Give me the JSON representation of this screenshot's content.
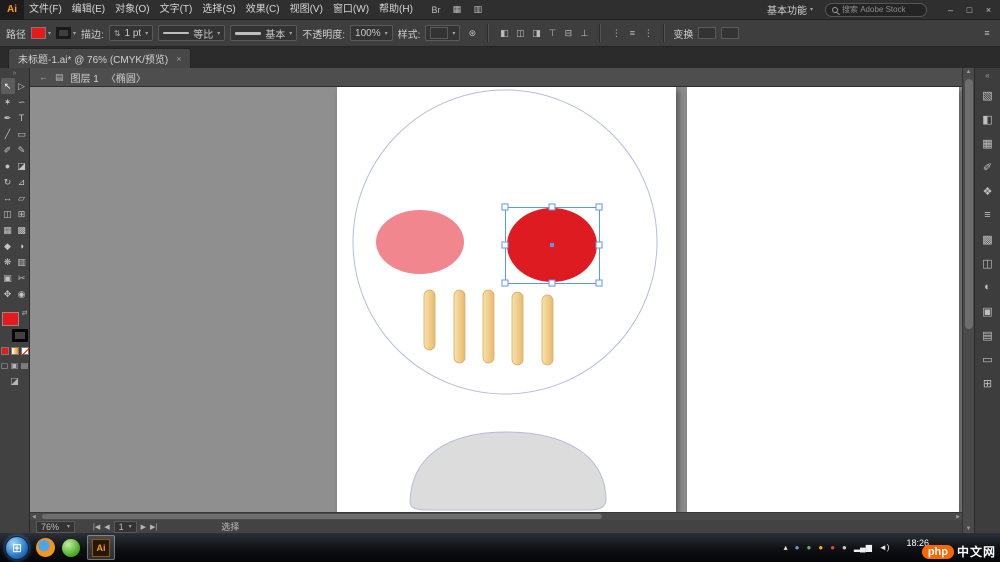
{
  "glyphs": {
    "caret_down": "▾",
    "stepper": "⇅",
    "back_arrow": "←",
    "layers": "▤",
    "dock_collapse": "«",
    "tools_collapse": "»",
    "panel_menu": "≡",
    "recolor": "⊛",
    "nav_first": "|◀",
    "nav_prev": "◀",
    "nav_next": "▶",
    "nav_last": "▶|",
    "scroll_up": "▲",
    "scroll_down": "▼",
    "scroll_left": "◀",
    "scroll_right": "▶",
    "swap": "⇄",
    "close_tab": "×",
    "start_flag": "⊞"
  },
  "menubar": {
    "app_badge": "Ai",
    "menus": [
      {
        "name": "menu-file",
        "label": "文件(F)"
      },
      {
        "name": "menu-edit",
        "label": "编辑(E)"
      },
      {
        "name": "menu-object",
        "label": "对象(O)"
      },
      {
        "name": "menu-type",
        "label": "文字(T)"
      },
      {
        "name": "menu-select",
        "label": "选择(S)"
      },
      {
        "name": "menu-effect",
        "label": "效果(C)"
      },
      {
        "name": "menu-view",
        "label": "视图(V)"
      },
      {
        "name": "menu-window",
        "label": "窗口(W)"
      },
      {
        "name": "menu-help",
        "label": "帮助(H)"
      }
    ],
    "appbar_icons": [
      {
        "name": "bridge-icon",
        "glyph": "Br"
      },
      {
        "name": "arrange-documents-icon",
        "glyph": "▦"
      },
      {
        "name": "document-layout-icon",
        "glyph": "▥"
      }
    ],
    "workspace_switcher": "基本功能",
    "search_placeholder": "搜索 Adobe Stock",
    "window_controls": [
      {
        "name": "minimize-button",
        "glyph": "–"
      },
      {
        "name": "restore-button",
        "glyph": "□"
      },
      {
        "name": "close-button",
        "glyph": "×"
      }
    ]
  },
  "control_bar": {
    "object_label": "路径",
    "fill_color": "#e8191c",
    "stroke_color": "#1a1a1a",
    "stroke_label": "描边:",
    "stroke_width": "1 pt",
    "profile_name": "等比",
    "brush_name": "基本",
    "opacity_label": "不透明度:",
    "opacity_value": "100%",
    "style_label": "样式:",
    "transform_label": "变换",
    "align_icons": [
      {
        "name": "align-left-icon",
        "glyph": "◧"
      },
      {
        "name": "align-center-horizontal-icon",
        "glyph": "◫"
      },
      {
        "name": "align-right-icon",
        "glyph": "◨"
      },
      {
        "name": "align-top-icon",
        "glyph": "⊤"
      },
      {
        "name": "align-center-vertical-icon",
        "glyph": "⊟"
      },
      {
        "name": "align-bottom-icon",
        "glyph": "⊥"
      }
    ],
    "distribute_icons": [
      {
        "name": "distribute-vertical-icon",
        "glyph": "⋮"
      },
      {
        "name": "distribute-center-icon",
        "glyph": "≡"
      },
      {
        "name": "distribute-horizontal-icon",
        "glyph": "⋮"
      }
    ]
  },
  "document_tab": {
    "title": "未标题-1.ai* @ 76% (CMYK/预览)"
  },
  "breadcrumb": {
    "items": [
      {
        "name": "breadcrumb-layer",
        "label": "图层 1"
      },
      {
        "name": "breadcrumb-ellipse",
        "label": "〈椭圆〉"
      }
    ]
  },
  "tools": [
    {
      "name": "selection-tool",
      "glyph": "↖"
    },
    {
      "name": "direct-selection-tool",
      "glyph": "▷"
    },
    {
      "name": "magic-wand-tool",
      "glyph": "✶"
    },
    {
      "name": "lasso-tool",
      "glyph": "∽"
    },
    {
      "name": "pen-tool",
      "glyph": "✒"
    },
    {
      "name": "type-tool",
      "glyph": "T"
    },
    {
      "name": "line-segment-tool",
      "glyph": "╱"
    },
    {
      "name": "rectangle-tool",
      "glyph": "▭"
    },
    {
      "name": "paintbrush-tool",
      "glyph": "✐"
    },
    {
      "name": "pencil-tool",
      "glyph": "✎"
    },
    {
      "name": "blob-brush-tool",
      "glyph": "●"
    },
    {
      "name": "eraser-tool",
      "glyph": "◪"
    },
    {
      "name": "rotate-tool",
      "glyph": "↻"
    },
    {
      "name": "scale-tool",
      "glyph": "⊿"
    },
    {
      "name": "width-tool",
      "glyph": "↔"
    },
    {
      "name": "free-transform-tool",
      "glyph": "▱"
    },
    {
      "name": "shape-builder-tool",
      "glyph": "◫"
    },
    {
      "name": "perspective-grid-tool",
      "glyph": "⊞"
    },
    {
      "name": "mesh-tool",
      "glyph": "▦"
    },
    {
      "name": "gradient-tool",
      "glyph": "▩"
    },
    {
      "name": "eyedropper-tool",
      "glyph": "◆"
    },
    {
      "name": "blend-tool",
      "glyph": "◑"
    },
    {
      "name": "symbol-sprayer-tool",
      "glyph": "❋"
    },
    {
      "name": "column-graph-tool",
      "glyph": "▥"
    },
    {
      "name": "artboard-tool",
      "glyph": "▣"
    },
    {
      "name": "slice-tool",
      "glyph": "✂"
    },
    {
      "name": "hand-tool",
      "glyph": "✥"
    },
    {
      "name": "zoom-tool",
      "glyph": "◉"
    }
  ],
  "tool_footer": {
    "modes": [
      {
        "name": "draw-normal-mode-icon",
        "glyph": "▢"
      },
      {
        "name": "draw-behind-mode-icon",
        "glyph": "▣"
      },
      {
        "name": "draw-inside-mode-icon",
        "glyph": "▤"
      }
    ],
    "screen_mode_glyph": "◪"
  },
  "dock_icons": [
    {
      "name": "color-panel-icon",
      "glyph": "▧"
    },
    {
      "name": "color-guide-panel-icon",
      "glyph": "◧"
    },
    {
      "name": "swatches-panel-icon",
      "glyph": "▦"
    },
    {
      "name": "brushes-panel-icon",
      "glyph": "✐"
    },
    {
      "name": "symbols-panel-icon",
      "glyph": "❖"
    },
    {
      "name": "stroke-panel-icon",
      "glyph": "≡"
    },
    {
      "name": "gradient-panel-icon",
      "glyph": "▩"
    },
    {
      "name": "transparency-panel-icon",
      "glyph": "◫"
    },
    {
      "name": "appearance-panel-icon",
      "glyph": "◐"
    },
    {
      "name": "graphic-styles-panel-icon",
      "glyph": "▣"
    },
    {
      "name": "layers-panel-icon",
      "glyph": "▤"
    },
    {
      "name": "artboards-panel-icon",
      "glyph": "▭"
    },
    {
      "name": "align-panel-icon",
      "glyph": "⊞"
    }
  ],
  "status_bar": {
    "zoom": "76%",
    "page": "1",
    "tool_status": "选择"
  },
  "artwork": {
    "face_stroke": "#b6bdd6",
    "left_eye_fill": "#f1868f",
    "right_eye_fill": "#dd1b21",
    "tooth_color_top": "#f8e2ab",
    "tooth_color_bottom": "#e8b96e",
    "tooth_stroke": "#d9ae64",
    "chin_fill": "#dcdcdc",
    "chin_stroke": "#b6bdd6",
    "selection_color": "#6395e6"
  },
  "taskbar": {
    "illustrator_badge": "Ai",
    "tray_icons": [
      {
        "name": "hidden-icons-chevron",
        "glyph": "▴",
        "color": "#e2e2e2"
      },
      {
        "name": "tray-app-blue-icon",
        "glyph": "●",
        "color": "#58a0d8"
      },
      {
        "name": "tray-app-green-icon",
        "glyph": "●",
        "color": "#69b83f"
      },
      {
        "name": "tray-app-yellow-icon",
        "glyph": "●",
        "color": "#f0b02c"
      },
      {
        "name": "tray-app-red-icon",
        "glyph": "●",
        "color": "#df4a30"
      },
      {
        "name": "tray-app-gray-icon",
        "glyph": "●",
        "color": "#c9c9c9"
      },
      {
        "name": "network-icon",
        "glyph": "▂▄▆",
        "color": "#efefef"
      },
      {
        "name": "volume-icon",
        "glyph": "◄)",
        "color": "#efefef"
      }
    ],
    "clock": "18:26",
    "watermark": {
      "badge": "php",
      "text": "中文网",
      "badge_color": "#ff6600"
    }
  }
}
